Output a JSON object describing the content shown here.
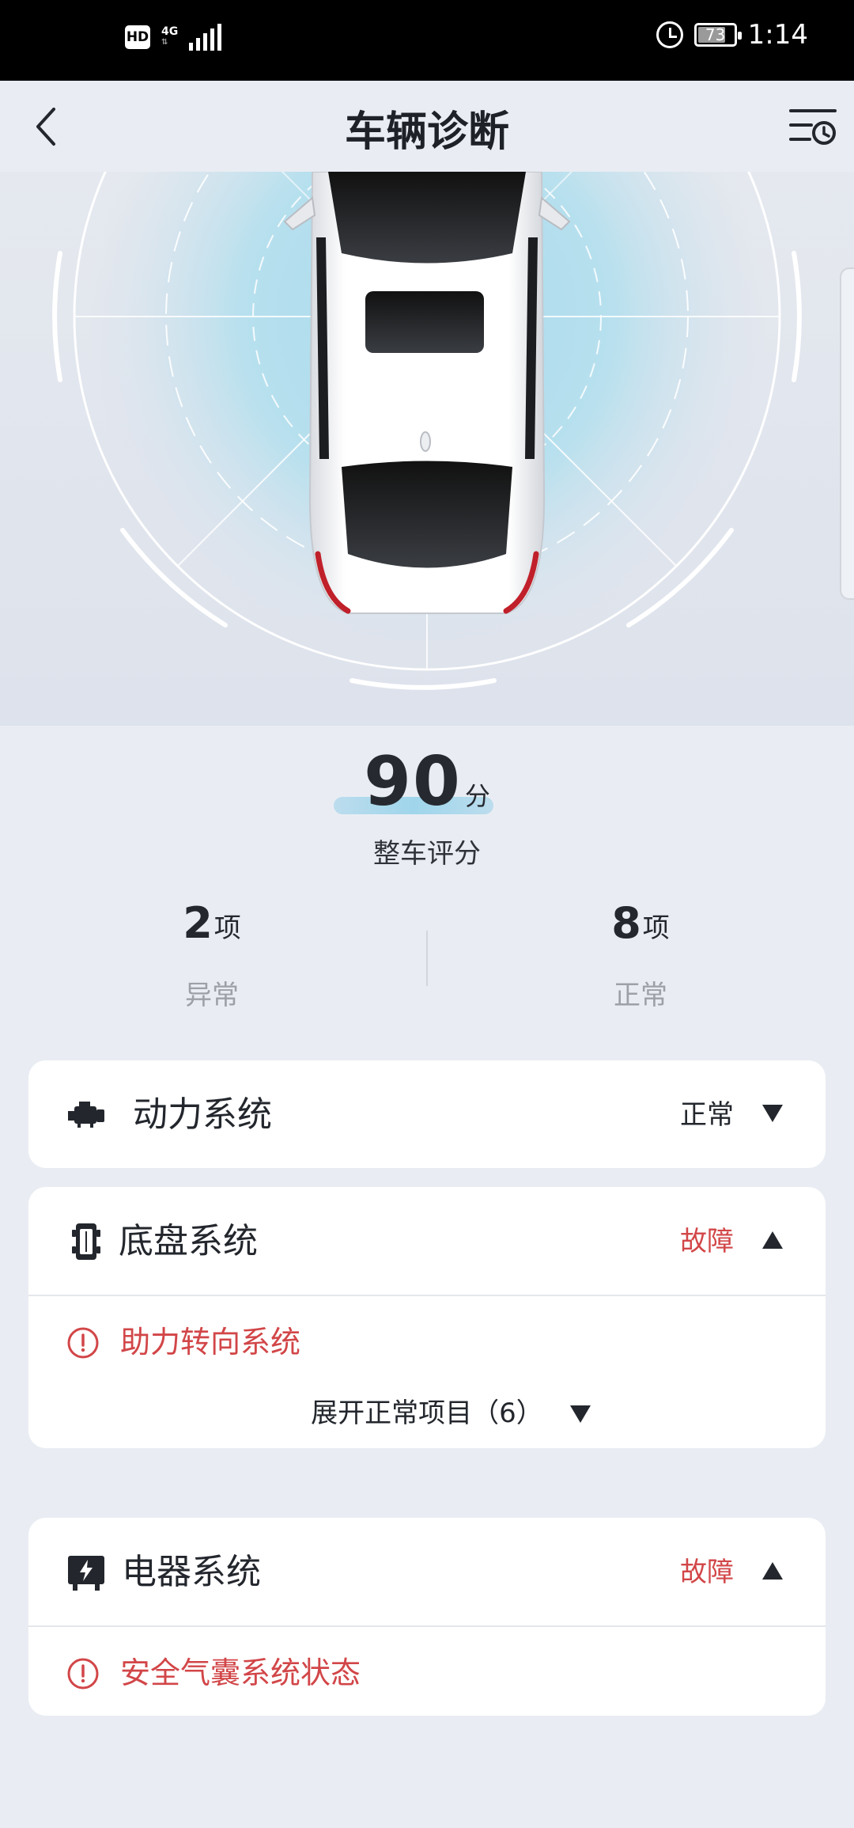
{
  "status_bar": {
    "hd": "HD",
    "network": "4G",
    "battery": "73",
    "time": "1:14"
  },
  "header": {
    "title": "车辆诊断"
  },
  "summary": {
    "score": "90",
    "score_unit": "分",
    "score_label": "整车评分",
    "abnormal": {
      "count": "2",
      "unit": "项",
      "label": "异常"
    },
    "normal": {
      "count": "8",
      "unit": "项",
      "label": "正常"
    }
  },
  "systems": [
    {
      "title": "动力系统",
      "status": "正常",
      "icon": "engine-icon",
      "expanded": false
    },
    {
      "title": "底盘系统",
      "status": "故障",
      "icon": "chassis-icon",
      "expanded": true,
      "faults": [
        "助力转向系统"
      ],
      "expand_label": "展开正常项目（6）"
    },
    {
      "title": "电器系统",
      "status": "故障",
      "icon": "electrical-icon",
      "expanded": true,
      "faults": [
        "安全气囊系统状态"
      ]
    }
  ],
  "colors": {
    "fault": "#d24648",
    "normal_text": "#23272d",
    "accent_blue": "#9fd5eb",
    "background": "#e9edf3"
  },
  "icons": {
    "back": "back-arrow-icon",
    "history": "history-list-icon",
    "alarm": "alarm-icon",
    "signal": "signal-icon",
    "battery": "battery-icon",
    "collapsed": "triangle-down-icon",
    "expanded": "triangle-up-icon",
    "fault": "alert-circle-icon"
  }
}
